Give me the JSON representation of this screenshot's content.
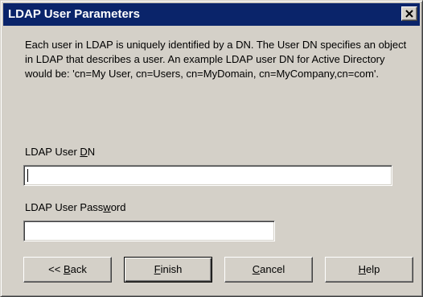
{
  "dialog": {
    "title": "LDAP User Parameters",
    "description": "Each user in LDAP is uniquely identified by a DN.  The User DN specifies an object in LDAP that describes a user.  An example LDAP user DN for Active Directory would be: 'cn=My User, cn=Users, cn=MyDomain, cn=MyCompany,cn=com'."
  },
  "fields": {
    "user_dn": {
      "label_pre": "LDAP User ",
      "label_key": "D",
      "label_post": "N",
      "value": ""
    },
    "password": {
      "label_pre": "LDAP User Pass",
      "label_key": "w",
      "label_post": "ord",
      "value": ""
    }
  },
  "buttons": {
    "back": {
      "pre": "<< ",
      "key": "B",
      "post": "ack"
    },
    "finish": {
      "pre": "",
      "key": "F",
      "post": "inish"
    },
    "cancel": {
      "pre": "",
      "key": "C",
      "post": "ancel"
    },
    "help": {
      "pre": "",
      "key": "H",
      "post": "elp"
    }
  },
  "icons": {
    "close": "close-icon"
  },
  "colors": {
    "titlebar": "#0a246a",
    "face": "#d4d0c8"
  }
}
